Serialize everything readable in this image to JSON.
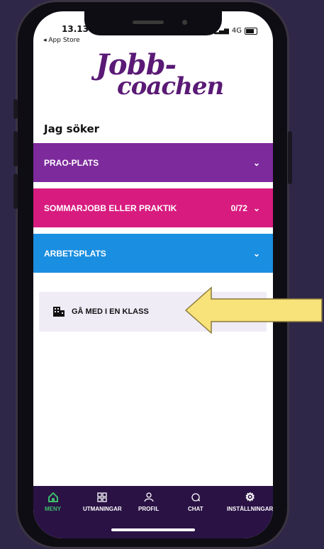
{
  "status_bar": {
    "time": "13.13",
    "back_label": "◂ App Store",
    "network": "4G"
  },
  "logo": {
    "line1": "Jobb-",
    "line2": "coachen"
  },
  "section_title": "Jag söker",
  "accordions": [
    {
      "label": "PRAO-PLATS",
      "count": "",
      "color": "#7d2a9c"
    },
    {
      "label": "SOMMARJOBB ELLER PRAKTIK",
      "count": "0/72",
      "color": "#d81b7f"
    },
    {
      "label": "ARBETSPLATS",
      "count": "",
      "color": "#1a8ee0"
    }
  ],
  "join_class": {
    "label": "GÅ MED I EN KLASS"
  },
  "tabbar": {
    "items": [
      {
        "label": "MENY",
        "icon": "home-icon",
        "active": true
      },
      {
        "label": "UTMANINGAR",
        "icon": "grid-icon",
        "active": false
      },
      {
        "label": "PROFIL",
        "icon": "person-icon",
        "active": false
      },
      {
        "label": "CHAT",
        "icon": "chat-icon",
        "active": false
      },
      {
        "label": "INSTÄLLNINGAR",
        "icon": "gear-icon",
        "active": false
      }
    ],
    "active_color": "#3dbb6b"
  },
  "callout": {
    "color": "#f8e27a",
    "type": "arrow-left"
  }
}
